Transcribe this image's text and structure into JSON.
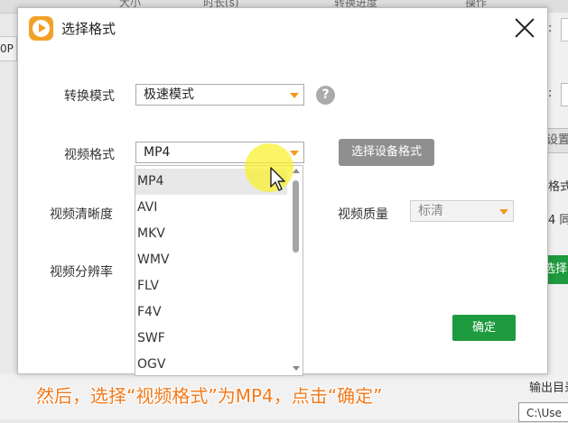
{
  "background": {
    "columns": [
      "大小",
      "时长(s)",
      "转换进度",
      "操作"
    ],
    "left_text": "0P",
    "right_labels": [
      ":",
      ":",
      "格式",
      "4 同"
    ],
    "settings_button": "设置",
    "green_button": "选择",
    "output_dir_label": "输出目录",
    "output_path": "C:\\Use"
  },
  "dialog": {
    "title": "选择格式",
    "convert_mode_label": "转换模式",
    "convert_mode_value": "极速模式",
    "help_glyph": "?",
    "video_format_label": "视频格式",
    "video_format_value": "MP4",
    "device_format_button": "选择设备格式",
    "clarity_label": "视频清晰度",
    "quality_label": "视频质量",
    "quality_value": "标清",
    "resolution_label": "视频分辨率",
    "ok_button": "确定"
  },
  "dropdown": {
    "options": [
      "MP4",
      "AVI",
      "MKV",
      "WMV",
      "FLV",
      "F4V",
      "SWF",
      "OGV"
    ],
    "selected_index": 0
  },
  "caption": "然后，选择“视频格式”为MP4，点击“确定”",
  "colors": {
    "accent_orange": "#f29a1e",
    "ok_green": "#1e9a3f",
    "device_button_gray": "#8f8f8f",
    "caption_orange": "#f07a1c"
  }
}
